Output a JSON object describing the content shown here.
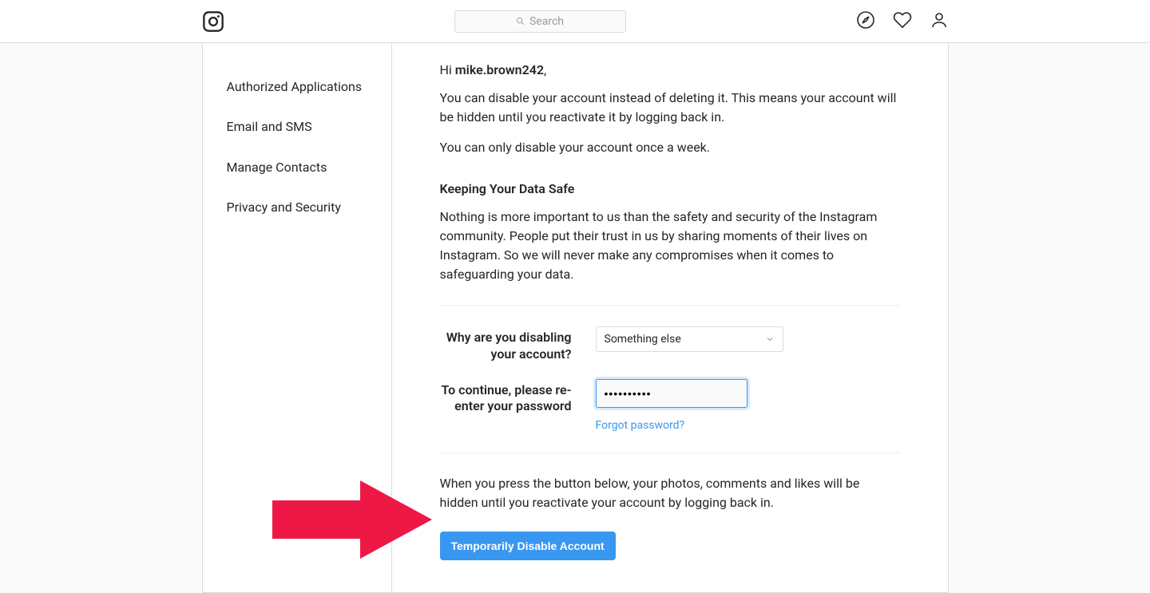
{
  "header": {
    "search_placeholder": "Search"
  },
  "sidebar": {
    "items": [
      {
        "label": "Authorized Applications"
      },
      {
        "label": "Email and SMS"
      },
      {
        "label": "Manage Contacts"
      },
      {
        "label": "Privacy and Security"
      }
    ]
  },
  "main": {
    "greeting_prefix": "Hi ",
    "username": "mike.brown242",
    "greeting_suffix": ",",
    "para1": "You can disable your account instead of deleting it. This means your account will be hidden until you reactivate it by logging back in.",
    "para2": "You can only disable your account once a week.",
    "section_heading": "Keeping Your Data Safe",
    "para3": "Nothing is more important to us than the safety and security of the Instagram community. People put their trust in us by sharing moments of their lives on Instagram. So we will never make any compromises when it comes to safeguarding your data.",
    "reason_label": "Why are you disabling your account?",
    "reason_value": "Something else",
    "password_label": "To continue, please re-enter your password",
    "password_value": "••••••••••",
    "forgot_password": "Forgot password?",
    "warning": "When you press the button below, your photos, comments and likes will be hidden until you reactivate your account by logging back in.",
    "disable_button": "Temporarily Disable Account"
  }
}
